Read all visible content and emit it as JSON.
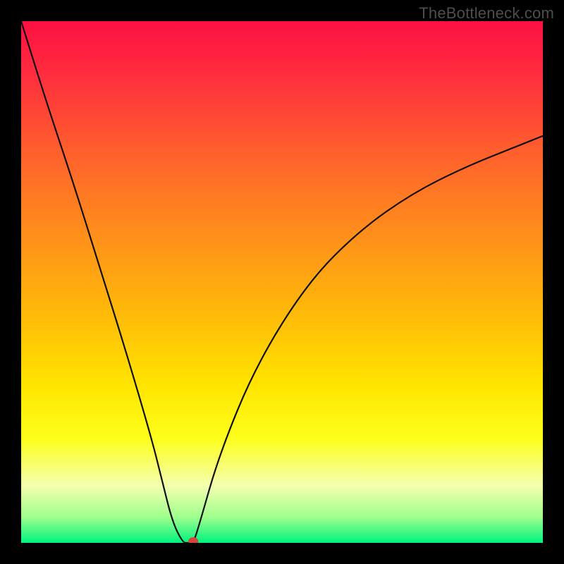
{
  "watermark": "TheBottleneck.com",
  "chart_data": {
    "type": "line",
    "title": "",
    "xlabel": "",
    "ylabel": "",
    "ylim": [
      0,
      100
    ],
    "xlim": [
      0,
      100
    ],
    "x": [
      0,
      5,
      10,
      15,
      20,
      25,
      27,
      29,
      31,
      32,
      33,
      34,
      38,
      45,
      55,
      65,
      75,
      85,
      95,
      100
    ],
    "values": [
      100,
      84,
      69,
      53,
      37,
      20,
      12,
      4,
      0,
      0,
      0,
      3,
      17,
      34,
      50,
      60,
      67,
      72,
      76,
      78
    ],
    "series": [
      {
        "name": "bottleneck-curve",
        "values": [
          100,
          84,
          69,
          53,
          37,
          20,
          12,
          4,
          0,
          0,
          0,
          3,
          17,
          34,
          50,
          60,
          67,
          72,
          76,
          78
        ]
      }
    ],
    "marker": {
      "x": 33,
      "y": 0
    }
  },
  "colors": {
    "gradient_top": "#fd1042",
    "gradient_bottom": "#00f37e",
    "curve": "#111111",
    "marker": "#d9443a",
    "frame": "#000000"
  }
}
